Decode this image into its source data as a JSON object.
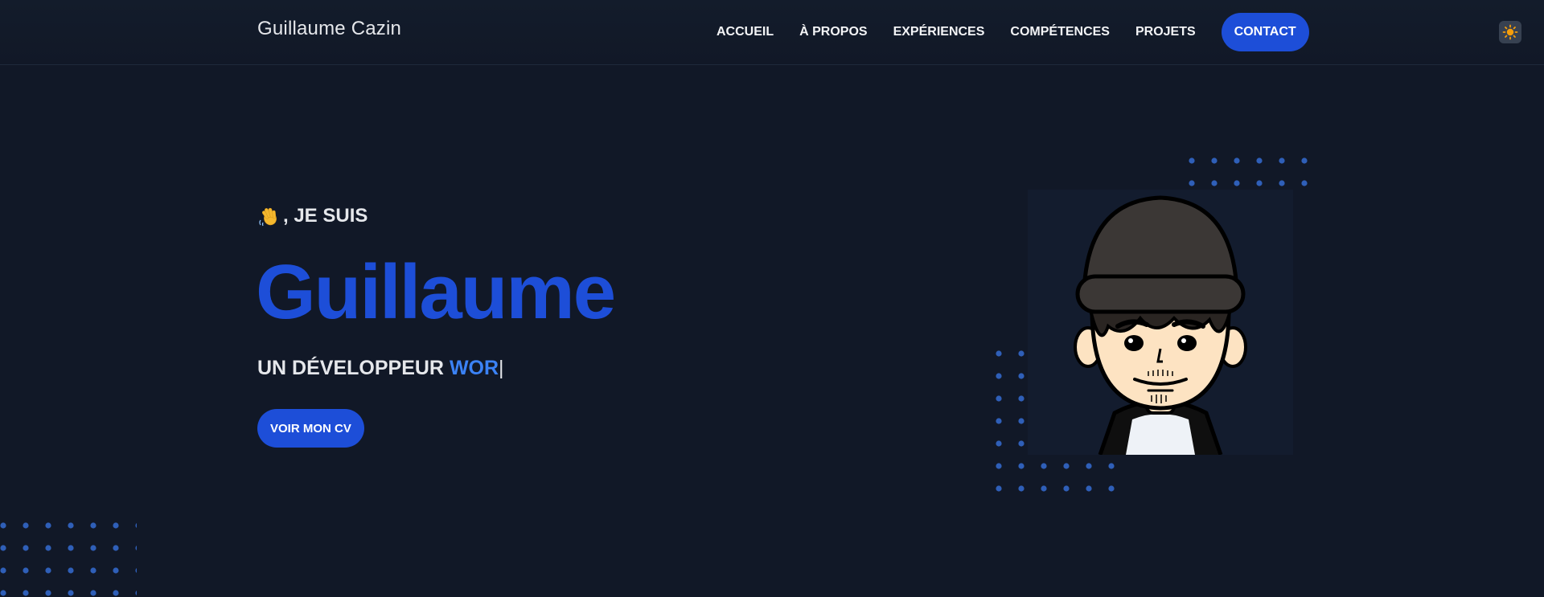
{
  "header": {
    "brand": "Guillaume Cazin",
    "nav": [
      "ACCUEIL",
      "À PROPOS",
      "EXPÉRIENCES",
      "COMPÉTENCES",
      "PROJETS"
    ],
    "contact_label": "CONTACT",
    "theme_toggle_icon": "sun-icon"
  },
  "hero": {
    "greeting_icon": "waving-hand-icon",
    "greeting_text": ", JE SUIS",
    "name": "Guillaume",
    "subtitle_prefix": "UN DÉVELOPPEUR ",
    "subtitle_typed": "WOR",
    "cursor": "|",
    "cv_button": "VOIR MON CV",
    "avatar": "cartoon-avatar-beanie"
  },
  "colors": {
    "background": "#111827",
    "accent": "#1d4ed8",
    "accent_light": "#3b82f6",
    "dots": "#2f5fb8"
  }
}
